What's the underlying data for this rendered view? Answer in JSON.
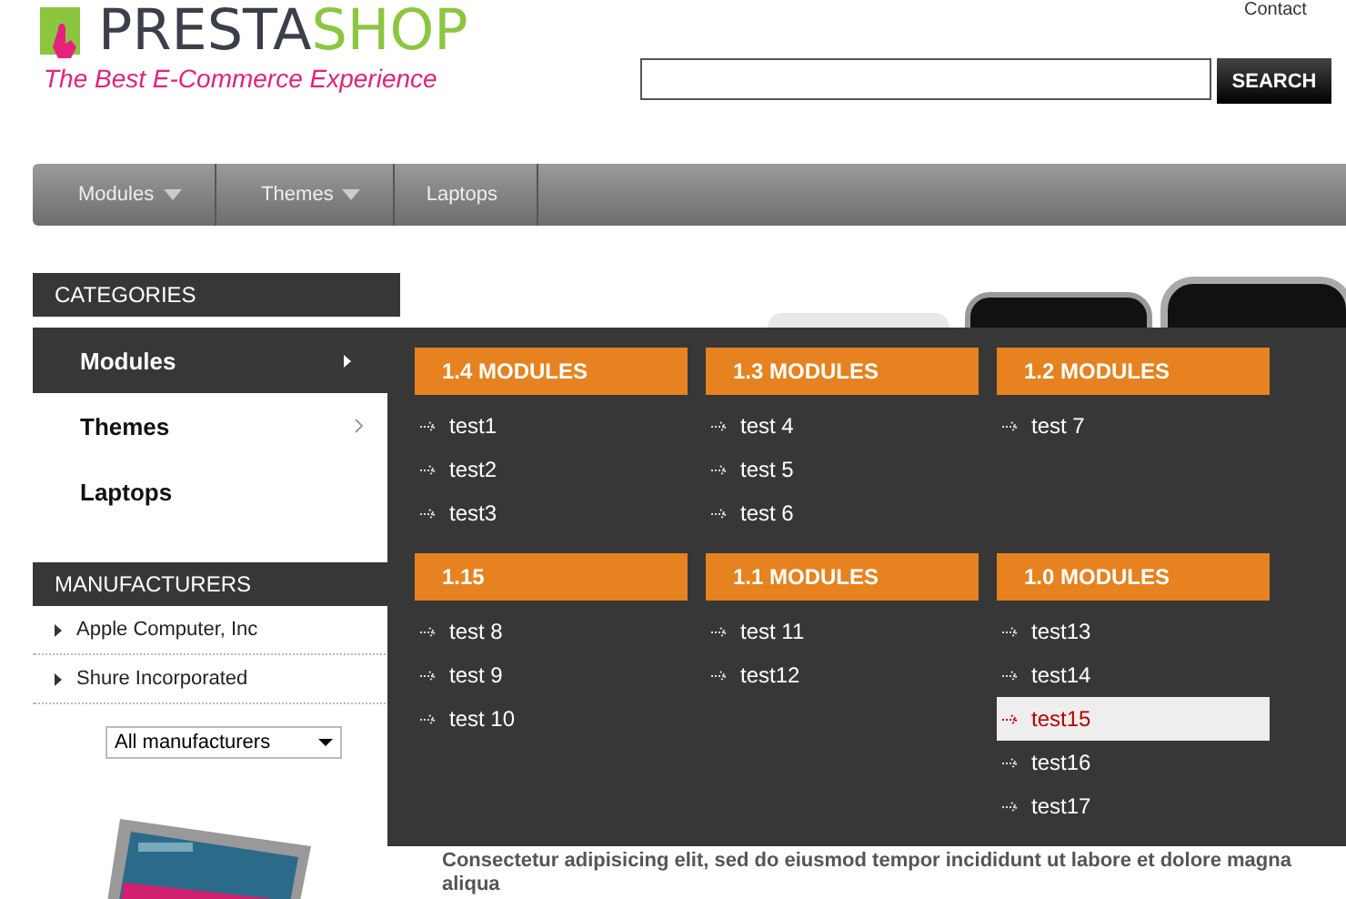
{
  "header": {
    "logo": {
      "part1": "PRESTA",
      "part2": "SHOP",
      "tagline": "The Best E-Commerce Experience"
    },
    "top_link": "Contact",
    "search": {
      "button": "SEARCH"
    }
  },
  "nav": [
    {
      "label": "Modules",
      "has_dropdown": true
    },
    {
      "label": "Themes",
      "has_dropdown": true
    },
    {
      "label": "Laptops",
      "has_dropdown": false
    }
  ],
  "categories": {
    "title": "CATEGORIES",
    "items": [
      {
        "label": "Modules",
        "selected": true
      },
      {
        "label": "Themes",
        "selected": false
      },
      {
        "label": "Laptops",
        "selected": false,
        "has_arrow": false
      }
    ]
  },
  "manufacturers": {
    "title": "MANUFACTURERS",
    "items": [
      "Apple Computer, Inc",
      "Shure Incorporated"
    ],
    "select": "All manufacturers"
  },
  "mega_menu": {
    "groups": [
      {
        "title": "1.4 MODULES",
        "items": [
          {
            "label": "test1",
            "selected": false
          },
          {
            "label": "test2",
            "selected": false
          },
          {
            "label": "test3",
            "selected": false
          }
        ]
      },
      {
        "title": "1.3 MODULES",
        "items": [
          {
            "label": "test 4",
            "selected": false
          },
          {
            "label": "test 5",
            "selected": false
          },
          {
            "label": "test 6",
            "selected": false
          }
        ]
      },
      {
        "title": "1.2 MODULES",
        "items": [
          {
            "label": "test 7",
            "selected": false
          }
        ]
      },
      {
        "title": "1.15",
        "items": [
          {
            "label": "test 8",
            "selected": false
          },
          {
            "label": "test 9",
            "selected": false
          },
          {
            "label": "test 10",
            "selected": false
          }
        ]
      },
      {
        "title": "1.1 MODULES",
        "items": [
          {
            "label": "test 11",
            "selected": false
          },
          {
            "label": "test12",
            "selected": false
          }
        ]
      },
      {
        "title": "1.0 MODULES",
        "items": [
          {
            "label": "test13",
            "selected": false
          },
          {
            "label": "test14",
            "selected": false
          },
          {
            "label": "test15",
            "selected": true
          },
          {
            "label": "test16",
            "selected": false
          },
          {
            "label": "test17",
            "selected": false
          }
        ]
      }
    ]
  },
  "content": {
    "text": "Consectetur adipisicing elit, sed do eiusmod tempor incididunt ut labore et dolore magna aliqua"
  }
}
